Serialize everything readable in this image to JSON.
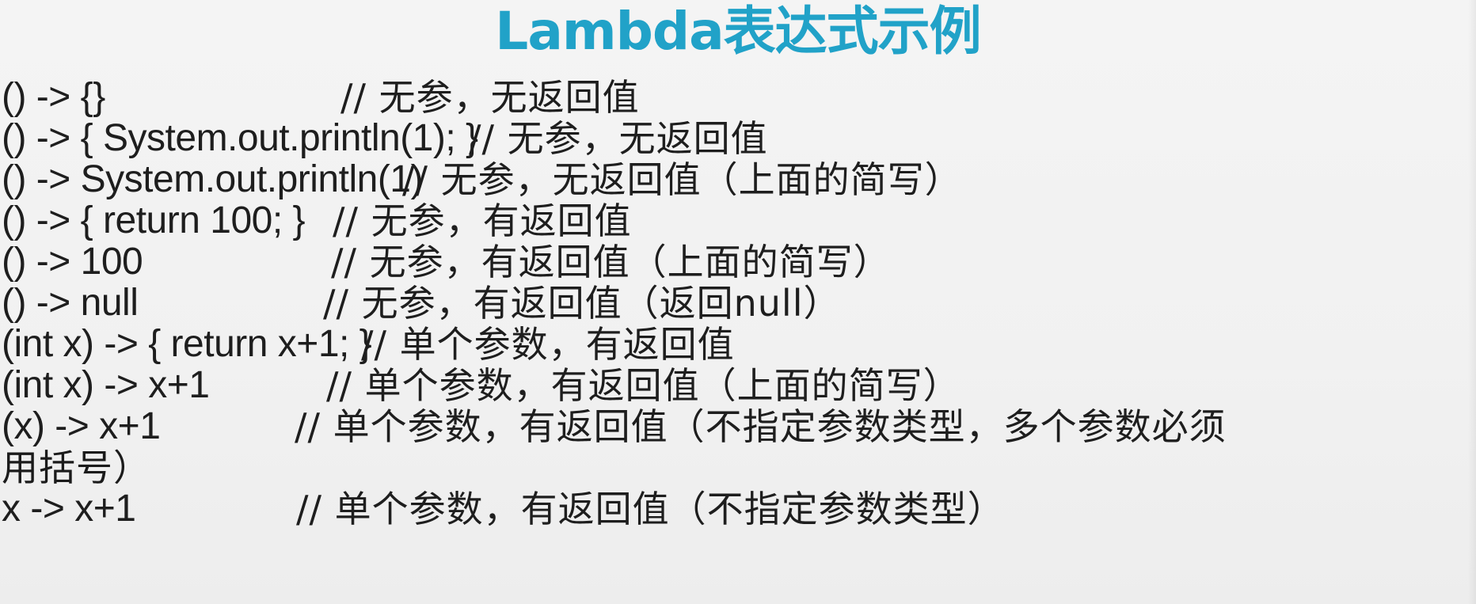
{
  "title": "Lambda表达式示例",
  "examples": [
    {
      "code": "() -> {}",
      "comment": "// 无参，无返回值"
    },
    {
      "code": "() -> { System.out.println(1); }",
      "comment": "// 无参，无返回值"
    },
    {
      "code": "() -> System.out.println(1)",
      "comment": "// 无参，无返回值（上面的简写）"
    },
    {
      "code": "() -> { return 100; }",
      "comment": "// 无参，有返回值"
    },
    {
      "code": "() -> 100",
      "comment": "// 无参，有返回值（上面的简写）"
    },
    {
      "code": "() -> null",
      "comment": "// 无参，有返回值（返回null）"
    },
    {
      "code": "(int x) -> { return x+1; }",
      "comment": "// 单个参数，有返回值"
    },
    {
      "code": "(int x) -> x+1",
      "comment": "// 单个参数，有返回值（上面的简写）"
    },
    {
      "code": "(x) -> x+1",
      "comment": "// 单个参数，有返回值（不指定参数类型，多个参数必须",
      "continuation": "用括号）"
    },
    {
      "code": "x -> x+1",
      "comment": "// 单个参数，有返回值（不指定参数类型）"
    }
  ],
  "colors": {
    "title": "#21a2c8",
    "text": "#1e1e1e",
    "background": "#f2f2f2"
  }
}
